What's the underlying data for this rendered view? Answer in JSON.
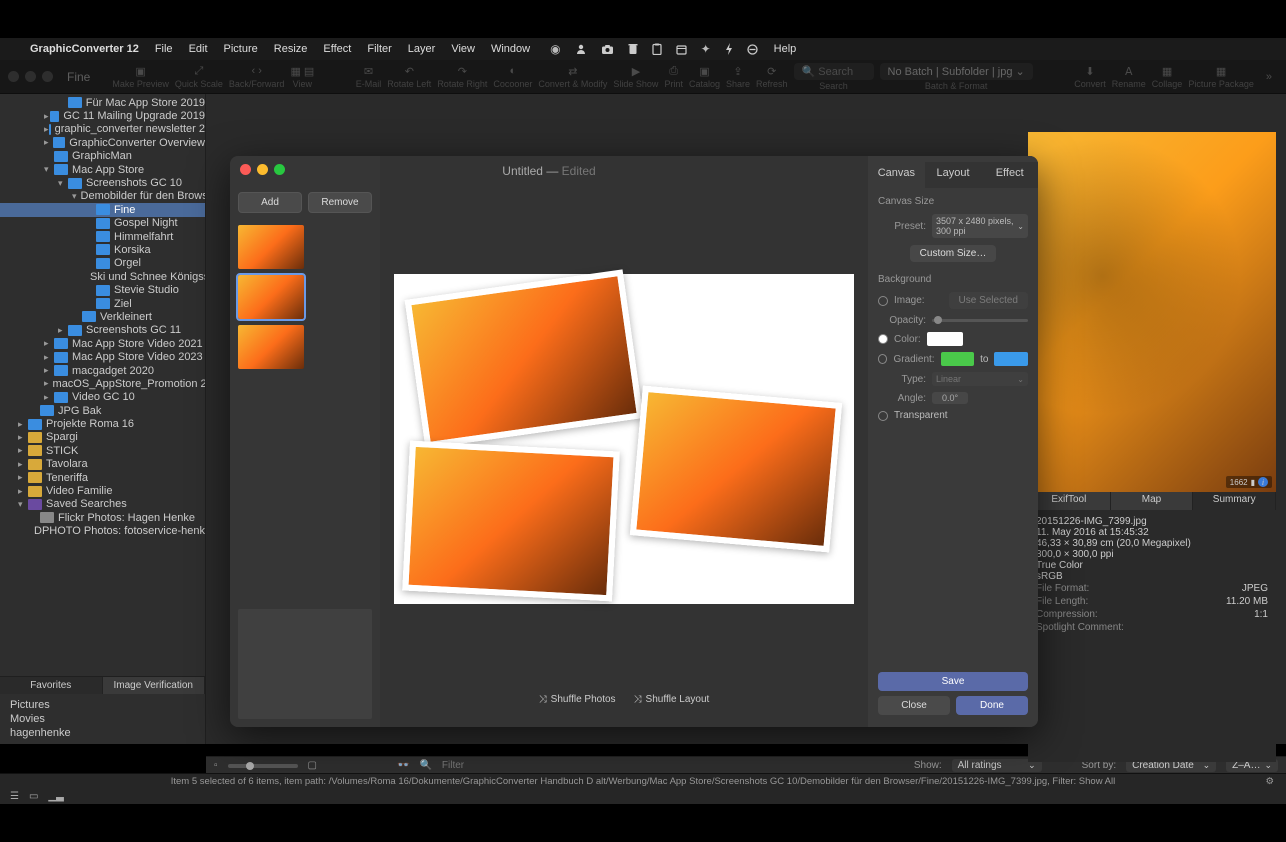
{
  "menubar": {
    "app": "GraphicConverter 12",
    "items": [
      "File",
      "Edit",
      "Picture",
      "Resize",
      "Effect",
      "Filter",
      "Layer",
      "View",
      "Window"
    ],
    "help": "Help"
  },
  "toolbar": {
    "title": "Fine",
    "make_preview": "Make Preview",
    "quick_scale": "Quick Scale",
    "back_forward": "Back/Forward",
    "view": "View",
    "email": "E-Mail",
    "rotate_left": "Rotate Left",
    "rotate_right": "Rotate Right",
    "cocooner": "Cocooner",
    "convert_modify": "Convert & Modify",
    "slideshow": "Slide Show",
    "print": "Print",
    "catalog": "Catalog",
    "share": "Share",
    "refresh": "Refresh",
    "search_ph": "Search",
    "search_lbl": "Search",
    "batch": "No Batch | Subfolder | jpg",
    "batch_lbl": "Batch & Format",
    "convert": "Convert",
    "rename": "Rename",
    "collage": "Collage",
    "picture_package": "Picture Package"
  },
  "tree": [
    {
      "i": 4,
      "d": 0,
      "c": "blue",
      "t": "Für Mac App Store 2019"
    },
    {
      "i": 3,
      "d": 1,
      "c": "blue",
      "t": "GC 11 Mailing Upgrade 2019"
    },
    {
      "i": 3,
      "d": 1,
      "c": "blue",
      "t": "graphic_converter newsletter 2"
    },
    {
      "i": 3,
      "d": 1,
      "c": "blue",
      "t": "GraphicConverter Overview"
    },
    {
      "i": 3,
      "d": 0,
      "c": "blue",
      "t": "GraphicMan"
    },
    {
      "i": 3,
      "d": 2,
      "c": "blue",
      "t": "Mac App Store"
    },
    {
      "i": 4,
      "d": 2,
      "c": "blue",
      "t": "Screenshots GC 10"
    },
    {
      "i": 5,
      "d": 2,
      "c": "blue",
      "t": "Demobilder für den Brows"
    },
    {
      "i": 6,
      "d": 0,
      "c": "blue",
      "t": "Fine",
      "sel": true
    },
    {
      "i": 6,
      "d": 0,
      "c": "blue",
      "t": "Gospel Night"
    },
    {
      "i": 6,
      "d": 0,
      "c": "blue",
      "t": "Himmelfahrt"
    },
    {
      "i": 6,
      "d": 0,
      "c": "blue",
      "t": "Korsika"
    },
    {
      "i": 6,
      "d": 0,
      "c": "blue",
      "t": "Orgel"
    },
    {
      "i": 6,
      "d": 0,
      "c": "blue",
      "t": "Ski und Schnee Königss"
    },
    {
      "i": 6,
      "d": 0,
      "c": "blue",
      "t": "Stevie Studio"
    },
    {
      "i": 6,
      "d": 0,
      "c": "blue",
      "t": "Ziel"
    },
    {
      "i": 5,
      "d": 0,
      "c": "blue",
      "t": "Verkleinert"
    },
    {
      "i": 4,
      "d": 1,
      "c": "blue",
      "t": "Screenshots GC 11"
    },
    {
      "i": 3,
      "d": 1,
      "c": "blue",
      "t": "Mac App Store Video 2021"
    },
    {
      "i": 3,
      "d": 1,
      "c": "blue",
      "t": "Mac App Store Video 2023"
    },
    {
      "i": 3,
      "d": 1,
      "c": "blue",
      "t": "macgadget 2020"
    },
    {
      "i": 3,
      "d": 1,
      "c": "blue",
      "t": "macOS_AppStore_Promotion 2"
    },
    {
      "i": 3,
      "d": 1,
      "c": "blue",
      "t": "Video GC 10"
    },
    {
      "i": 2,
      "d": 0,
      "c": "blue",
      "t": "JPG Bak"
    },
    {
      "i": 1,
      "d": 1,
      "c": "blue",
      "t": "Projekte Roma 16"
    },
    {
      "i": 1,
      "d": 1,
      "c": "yellow",
      "t": "Spargi"
    },
    {
      "i": 1,
      "d": 1,
      "c": "yellow",
      "t": "STICK"
    },
    {
      "i": 1,
      "d": 1,
      "c": "yellow",
      "t": "Tavolara"
    },
    {
      "i": 1,
      "d": 1,
      "c": "yellow",
      "t": "Teneriffa"
    },
    {
      "i": 1,
      "d": 1,
      "c": "yellow",
      "t": "Video Familie"
    },
    {
      "i": 1,
      "d": 2,
      "c": "smart",
      "t": "Saved Searches"
    },
    {
      "i": 2,
      "d": 0,
      "c": "gray",
      "t": "Flickr Photos: Hagen Henke"
    },
    {
      "i": 2,
      "d": 0,
      "c": "gray",
      "t": "DPHOTO Photos: fotoservice-henke"
    }
  ],
  "side_tabs": {
    "favorites": "Favorites",
    "verify": "Image Verification"
  },
  "favorites": [
    "Pictures",
    "Movies",
    "hagenhenke"
  ],
  "dialog": {
    "title": "Untitled",
    "edited": "Edited",
    "add": "Add",
    "remove": "Remove",
    "shuffle_photos": "Shuffle Photos",
    "shuffle_layout": "Shuffle Layout",
    "tabs": {
      "canvas": "Canvas",
      "layout": "Layout",
      "effect": "Effect"
    },
    "canvas_size": "Canvas Size",
    "preset_lbl": "Preset:",
    "preset_val": "3507 x 2480 pixels, 300 ppi",
    "custom_size": "Custom Size…",
    "background": "Background",
    "image": "Image:",
    "use_selected": "Use Selected",
    "opacity": "Opacity:",
    "color": "Color:",
    "gradient": "Gradient:",
    "to": "to",
    "type": "Type:",
    "type_val": "Linear",
    "angle": "Angle:",
    "angle_val": "0.0°",
    "transparent": "Transparent",
    "save": "Save",
    "close": "Close",
    "done": "Done"
  },
  "info_tabs": {
    "exif": "ExifTool",
    "map": "Map",
    "summary": "Summary"
  },
  "info": {
    "filename": "20151226-IMG_7399.jpg",
    "date": "11. May 2016 at 15:45:32",
    "dims": "46,33 × 30,89 cm (20,0 Megapixel)",
    "res": "300,0 × 300,0 ppi",
    "depth": "True Color",
    "profile": "sRGB",
    "format_k": "File Format:",
    "format_v": "JPEG",
    "length_k": "File Length:",
    "length_v": "11.20 MB",
    "compr_k": "Compression:",
    "compr_v": "1:1",
    "spot_k": "Spotlight Comment:"
  },
  "preview_badge": "1662",
  "browser_bottom": {
    "filter_ph": "Filter",
    "show": "Show:",
    "show_val": "All ratings",
    "sort": "Sort by:",
    "sort_val": "Creation Date",
    "sort_dir": "Z–A…"
  },
  "status": "Item 5 selected of 6 items, item path: /Volumes/Roma 16/Dokumente/GraphicConverter Handbuch D alt/Werbung/Mac App Store/Screenshots GC 10/Demobilder für den Browser/Fine/20151226-IMG_7399.jpg, Filter: Show All"
}
